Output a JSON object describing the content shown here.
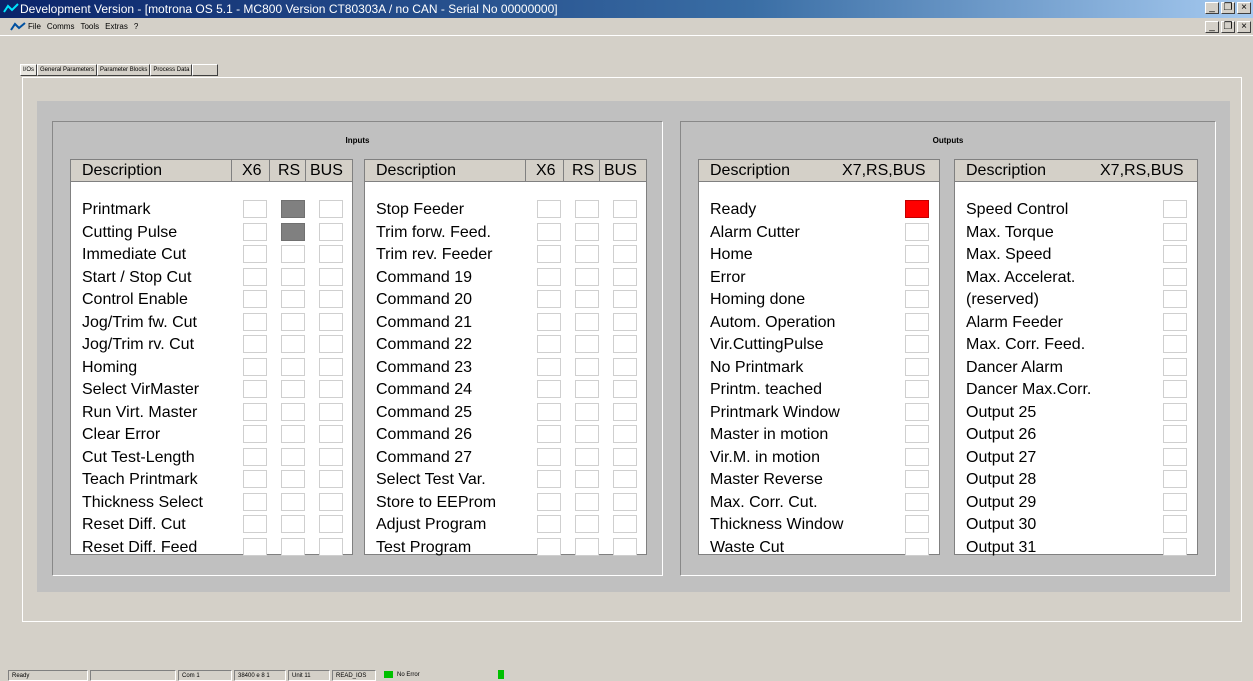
{
  "window": {
    "title": "Development Version - [motrona OS 5.1  - MC800 Version CT80303A / no CAN   - Serial No 00000000]",
    "controls": {
      "minimize": "_",
      "restore": "❐",
      "close": "×"
    }
  },
  "menubar": {
    "items": [
      "File",
      "Comms",
      "Tools",
      "Extras",
      "?"
    ]
  },
  "tabs": [
    {
      "label": "I/Os",
      "active": true
    },
    {
      "label": "General Parameters",
      "active": false
    },
    {
      "label": "Parameter Blocks",
      "active": false
    },
    {
      "label": "Process Data",
      "active": false
    },
    {
      "label": "",
      "active": false
    }
  ],
  "inputs": {
    "title": "Inputs",
    "columns": {
      "description": "Description",
      "x6": "X6",
      "rs": "RS",
      "bus": "BUS"
    },
    "left": [
      {
        "label": "Printmark",
        "x6": false,
        "rs": true,
        "bus": false
      },
      {
        "label": "Cutting Pulse",
        "x6": false,
        "rs": true,
        "bus": false
      },
      {
        "label": "Immediate Cut",
        "x6": false,
        "rs": false,
        "bus": false
      },
      {
        "label": "Start / Stop Cut",
        "x6": false,
        "rs": false,
        "bus": false
      },
      {
        "label": "Control Enable",
        "x6": false,
        "rs": false,
        "bus": false
      },
      {
        "label": "Jog/Trim fw. Cut",
        "x6": false,
        "rs": false,
        "bus": false
      },
      {
        "label": "Jog/Trim rv. Cut",
        "x6": false,
        "rs": false,
        "bus": false
      },
      {
        "label": "Homing",
        "x6": false,
        "rs": false,
        "bus": false
      },
      {
        "label": "Select VirMaster",
        "x6": false,
        "rs": false,
        "bus": false
      },
      {
        "label": "Run Virt. Master",
        "x6": false,
        "rs": false,
        "bus": false
      },
      {
        "label": "Clear Error",
        "x6": false,
        "rs": false,
        "bus": false
      },
      {
        "label": "Cut Test-Length",
        "x6": false,
        "rs": false,
        "bus": false
      },
      {
        "label": "Teach Printmark",
        "x6": false,
        "rs": false,
        "bus": false
      },
      {
        "label": "Thickness Select",
        "x6": false,
        "rs": false,
        "bus": false
      },
      {
        "label": "Reset Diff. Cut",
        "x6": false,
        "rs": false,
        "bus": false
      },
      {
        "label": "Reset Diff. Feed",
        "x6": false,
        "rs": false,
        "bus": false
      }
    ],
    "right": [
      {
        "label": "Stop Feeder",
        "x6": false,
        "rs": false,
        "bus": false
      },
      {
        "label": "Trim forw. Feed.",
        "x6": false,
        "rs": false,
        "bus": false
      },
      {
        "label": "Trim rev. Feeder",
        "x6": false,
        "rs": false,
        "bus": false
      },
      {
        "label": "Command 19",
        "x6": false,
        "rs": false,
        "bus": false
      },
      {
        "label": "Command 20",
        "x6": false,
        "rs": false,
        "bus": false
      },
      {
        "label": "Command 21",
        "x6": false,
        "rs": false,
        "bus": false
      },
      {
        "label": "Command 22",
        "x6": false,
        "rs": false,
        "bus": false
      },
      {
        "label": "Command 23",
        "x6": false,
        "rs": false,
        "bus": false
      },
      {
        "label": "Command 24",
        "x6": false,
        "rs": false,
        "bus": false
      },
      {
        "label": "Command 25",
        "x6": false,
        "rs": false,
        "bus": false
      },
      {
        "label": "Command 26",
        "x6": false,
        "rs": false,
        "bus": false
      },
      {
        "label": "Command 27",
        "x6": false,
        "rs": false,
        "bus": false
      },
      {
        "label": "Select Test Var.",
        "x6": false,
        "rs": false,
        "bus": false
      },
      {
        "label": "Store to EEProm",
        "x6": false,
        "rs": false,
        "bus": false
      },
      {
        "label": "Adjust Program",
        "x6": false,
        "rs": false,
        "bus": false
      },
      {
        "label": "Test Program",
        "x6": false,
        "rs": false,
        "bus": false
      }
    ]
  },
  "outputs": {
    "title": "Outputs",
    "columns": {
      "description": "Description",
      "state": "X7,RS,BUS"
    },
    "left": [
      {
        "label": "Ready",
        "on": true
      },
      {
        "label": "Alarm Cutter",
        "on": false
      },
      {
        "label": "Home",
        "on": false
      },
      {
        "label": "Error",
        "on": false
      },
      {
        "label": "Homing done",
        "on": false
      },
      {
        "label": "Autom. Operation",
        "on": false
      },
      {
        "label": "Vir.CuttingPulse",
        "on": false
      },
      {
        "label": "No Printmark",
        "on": false
      },
      {
        "label": "Printm. teached",
        "on": false
      },
      {
        "label": "Printmark Window",
        "on": false
      },
      {
        "label": "Master in motion",
        "on": false
      },
      {
        "label": "Vir.M. in motion",
        "on": false
      },
      {
        "label": "Master Reverse",
        "on": false
      },
      {
        "label": "Max. Corr. Cut.",
        "on": false
      },
      {
        "label": "Thickness Window",
        "on": false
      },
      {
        "label": "Waste Cut",
        "on": false
      }
    ],
    "right": [
      {
        "label": "Speed Control",
        "on": false
      },
      {
        "label": "Max. Torque",
        "on": false
      },
      {
        "label": "Max. Speed",
        "on": false
      },
      {
        "label": "Max. Accelerat.",
        "on": false
      },
      {
        "label": "(reserved)",
        "on": false
      },
      {
        "label": "Alarm Feeder",
        "on": false
      },
      {
        "label": "Max. Corr. Feed.",
        "on": false
      },
      {
        "label": "Dancer Alarm",
        "on": false
      },
      {
        "label": "Dancer Max.Corr.",
        "on": false
      },
      {
        "label": "Output 25",
        "on": false
      },
      {
        "label": "Output 26",
        "on": false
      },
      {
        "label": "Output 27",
        "on": false
      },
      {
        "label": "Output 28",
        "on": false
      },
      {
        "label": "Output 29",
        "on": false
      },
      {
        "label": "Output 30",
        "on": false
      },
      {
        "label": "Output 31",
        "on": false
      }
    ]
  },
  "colors": {
    "input_active": "#808080",
    "output_alarm": "#ff0000",
    "status_ok": "#00c000"
  },
  "statusbar": {
    "ready": "Ready",
    "blank": "",
    "port": "Com 1",
    "baud": "38400 e 8 1",
    "unit": "Unit 11",
    "operation": "READ_IOS",
    "error": "No Error"
  }
}
